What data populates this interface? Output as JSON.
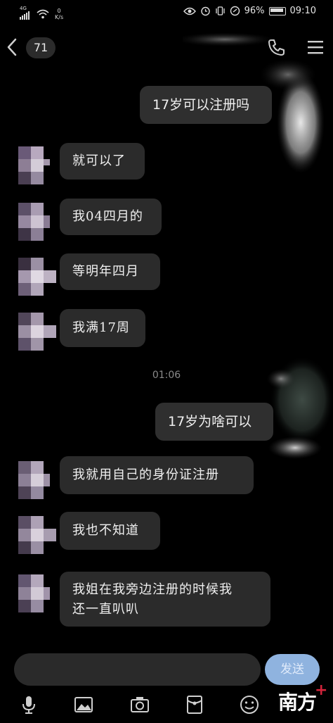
{
  "statusbar": {
    "network": "4G",
    "speed_value": "0",
    "speed_unit": "K/s",
    "battery": "96%",
    "time": "09:10"
  },
  "header": {
    "unread_count": "71"
  },
  "timestamp": "01:06",
  "messages": [
    {
      "side": "right",
      "text": "17岁可以注册吗"
    },
    {
      "side": "left",
      "text": "就可以了"
    },
    {
      "side": "left",
      "text": "我04四月的"
    },
    {
      "side": "left",
      "text": "等明年四月"
    },
    {
      "side": "left",
      "text": "我满17周"
    },
    {
      "side": "right",
      "text": "17岁为啥可以"
    },
    {
      "side": "left",
      "text": "我就用自己的身份证注册"
    },
    {
      "side": "left",
      "text": "我也不知道"
    },
    {
      "side": "left",
      "line1": "我姐在我旁边注册的时候我",
      "line2": "还一直叭叭"
    }
  ],
  "composer": {
    "placeholder": "",
    "send_label": "发送"
  },
  "watermark": {
    "text": "南方",
    "plus": "+"
  },
  "colors": {
    "background": "#000000",
    "bubble": "#2b2b2b",
    "send_button": "#8fb3df",
    "watermark_accent": "#d4243b"
  }
}
